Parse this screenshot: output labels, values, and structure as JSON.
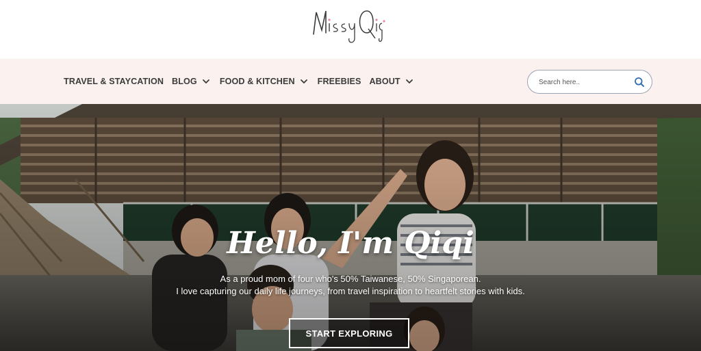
{
  "header": {
    "logo_text": "MissyQiqi",
    "colors": {
      "nav_bg": "#fbf1ef",
      "logo_dot": "#e38aa0"
    }
  },
  "nav": {
    "items": [
      {
        "label": "TRAVEL & STAYCATION",
        "has_dropdown": false
      },
      {
        "label": "BLOG",
        "has_dropdown": true
      },
      {
        "label": "FOOD & KITCHEN",
        "has_dropdown": true
      },
      {
        "label": "FREEBIES",
        "has_dropdown": false
      },
      {
        "label": "ABOUT",
        "has_dropdown": true
      }
    ]
  },
  "search": {
    "placeholder": "Search here..",
    "icon": "search-icon"
  },
  "hero": {
    "title": "Hello, I'm Qiqi",
    "subtitle_line1": "As a proud mom of four who's 50% Taiwanese, 50% Singaporean.",
    "subtitle_line2": "I love capturing our daily life journeys, from travel inspiration to heartfelt stories with kids.",
    "cta_label": "START EXPLORING"
  }
}
